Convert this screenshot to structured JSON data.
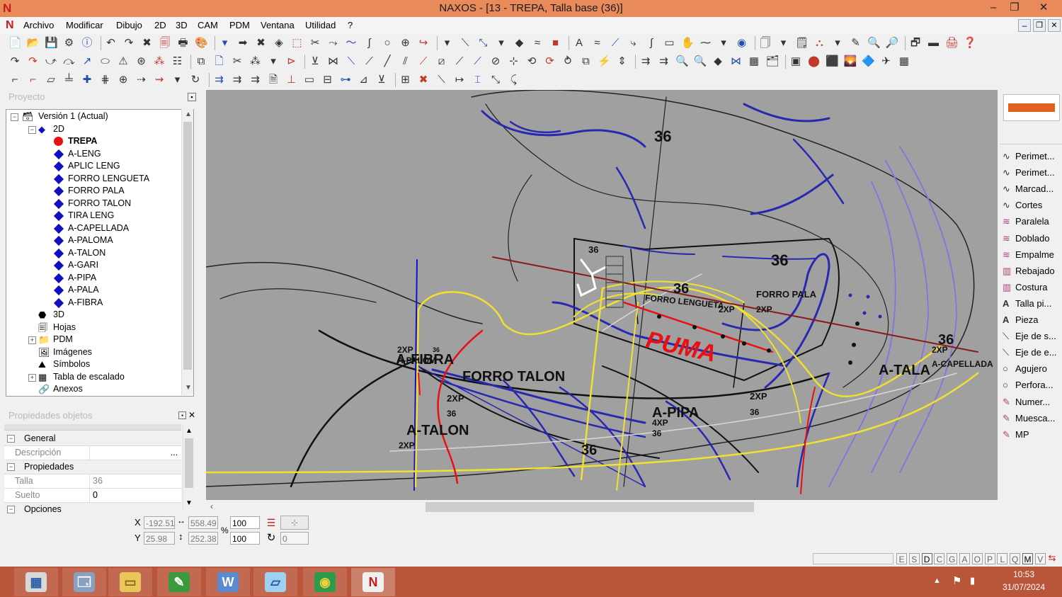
{
  "window": {
    "title": "NAXOS - [13 - TREPA, Talla base (36)]",
    "controls": [
      "‒",
      "❐",
      "✕"
    ],
    "mdi_controls": [
      "‒",
      "❐",
      "✕"
    ]
  },
  "menu": [
    "Archivo",
    "Modificar",
    "Dibujo",
    "2D",
    "3D",
    "CAM",
    "PDM",
    "Ventana",
    "Utilidad",
    "?"
  ],
  "proyecto": {
    "title": "Proyecto",
    "tree": [
      {
        "label": "Versión 1 (Actual)",
        "level": 0,
        "exp": "⊟",
        "icon": "version-icon"
      },
      {
        "label": "2D",
        "level": 1,
        "exp": "⊟",
        "icon": "2d-icon"
      },
      {
        "label": "TREPA",
        "level": 2,
        "icon": "red-dot",
        "bold": true
      },
      {
        "label": "A-LENG",
        "level": 2,
        "icon": "diamond"
      },
      {
        "label": "APLIC LENG",
        "level": 2,
        "icon": "diamond"
      },
      {
        "label": "FORRO LENGUETA",
        "level": 2,
        "icon": "diamond"
      },
      {
        "label": "FORRO PALA",
        "level": 2,
        "icon": "diamond"
      },
      {
        "label": "FORRO TALON",
        "level": 2,
        "icon": "diamond"
      },
      {
        "label": "TIRA LENG",
        "level": 2,
        "icon": "diamond"
      },
      {
        "label": "A-CAPELLADA",
        "level": 2,
        "icon": "diamond"
      },
      {
        "label": "A-PALOMA",
        "level": 2,
        "icon": "diamond"
      },
      {
        "label": "A-TALON",
        "level": 2,
        "icon": "diamond"
      },
      {
        "label": "A-GARI",
        "level": 2,
        "icon": "diamond"
      },
      {
        "label": "A-PIPA",
        "level": 2,
        "icon": "diamond"
      },
      {
        "label": "A-PALA",
        "level": 2,
        "icon": "diamond"
      },
      {
        "label": "A-FIBRA",
        "level": 2,
        "icon": "diamond"
      },
      {
        "label": "3D",
        "level": 1,
        "icon": "3d-icon"
      },
      {
        "label": "Hojas",
        "level": 1,
        "icon": "sheets-icon"
      },
      {
        "label": "PDM",
        "level": 1,
        "exp": "⊞",
        "icon": "folder-icon"
      },
      {
        "label": "Imágenes",
        "level": 1,
        "icon": "images-icon"
      },
      {
        "label": "Símbolos",
        "level": 1,
        "icon": "symbols-icon"
      },
      {
        "label": "Tabla de escalado",
        "level": 1,
        "exp": "⊞",
        "icon": "table-icon"
      },
      {
        "label": "Anexos",
        "level": 1,
        "icon": "attach-icon"
      }
    ]
  },
  "propiedades": {
    "title": "Propiedades objetos",
    "rows": [
      {
        "type": "section",
        "exp": "⊟",
        "label": "General"
      },
      {
        "type": "field",
        "label": "Descripción",
        "value": "",
        "button": "..."
      },
      {
        "type": "section",
        "exp": "⊟",
        "label": "Propiedades"
      },
      {
        "type": "field",
        "label": "Talla",
        "value": "36"
      },
      {
        "type": "field",
        "label": "Suelto",
        "value": "0"
      },
      {
        "type": "section",
        "exp": "⊟",
        "label": "Opciones"
      }
    ]
  },
  "right_panel": {
    "items": [
      {
        "label": "Perimet...",
        "icon": "curve-icon"
      },
      {
        "label": "Perimet...",
        "icon": "curve-icon"
      },
      {
        "label": "Marcad...",
        "icon": "curve-icon"
      },
      {
        "label": "Cortes",
        "icon": "curve-icon"
      },
      {
        "label": "Paralela",
        "icon": "parallel-icon"
      },
      {
        "label": "Doblado",
        "icon": "parallel-icon"
      },
      {
        "label": "Empalme",
        "icon": "parallel-icon"
      },
      {
        "label": "Rebajado",
        "icon": "bar-icon"
      },
      {
        "label": "Costura",
        "icon": "bar-icon"
      },
      {
        "label": "Talla pi...",
        "icon": "text-a-icon"
      },
      {
        "label": "Pieza",
        "icon": "text-a-icon"
      },
      {
        "label": "Eje de s...",
        "icon": "axis-icon"
      },
      {
        "label": "Eje de e...",
        "icon": "axis-icon"
      },
      {
        "label": "Agujero",
        "icon": "circle-icon"
      },
      {
        "label": "Perfora...",
        "icon": "circle-icon"
      },
      {
        "label": "Numer...",
        "icon": "pen-icon"
      },
      {
        "label": "Muesca...",
        "icon": "pen-icon"
      },
      {
        "label": "MP",
        "icon": "pen-icon"
      }
    ]
  },
  "canvas_labels": [
    {
      "text": "36",
      "bold": true
    },
    {
      "text": "36",
      "bold": true
    },
    {
      "text": "36",
      "bold": true
    },
    {
      "text": "36",
      "bold": true
    },
    {
      "text": "FORRO PALA",
      "bold": true
    },
    {
      "text": "2XP",
      "bold": true
    },
    {
      "text": "FORRO LENGUETA",
      "bold": true
    },
    {
      "text": "2XP",
      "bold": true
    },
    {
      "text": "36",
      "bold": true
    },
    {
      "text": "36",
      "bold": true
    },
    {
      "text": "A-TALA",
      "bold": true
    },
    {
      "text": "2XP",
      "bold": true
    },
    {
      "text": "A-CAPELLADA",
      "bold": true
    },
    {
      "text": "2XP",
      "bold": true
    },
    {
      "text": "36",
      "bold": true
    },
    {
      "text": "A-PIPA",
      "bold": true
    },
    {
      "text": "4XP",
      "bold": true
    },
    {
      "text": "36",
      "bold": true
    },
    {
      "text": "36",
      "bold": true
    },
    {
      "text": "FORRO TALON",
      "bold": true
    },
    {
      "text": "2XP",
      "bold": true
    },
    {
      "text": "36",
      "bold": true
    },
    {
      "text": "A-FIBRA",
      "bold": true
    },
    {
      "text": "2XP",
      "bold": true
    },
    {
      "text": "A-PALOM",
      "bold": true
    },
    {
      "text": "36",
      "bold": true
    },
    {
      "text": "A-TALON",
      "bold": true
    },
    {
      "text": "2XP",
      "bold": true
    },
    {
      "text": "PUMA",
      "bold": true
    }
  ],
  "coords": {
    "x_label": "X",
    "y_label": "Y",
    "x": "-192.51",
    "y": "25.98",
    "w": "558.49",
    "h": "252.38",
    "pct_label": "%",
    "scale_x": "100",
    "scale_y": "100",
    "angle": "0"
  },
  "status_letters": [
    "E",
    "S",
    "D",
    "C",
    "G",
    "A",
    "O",
    "P",
    "L",
    "Q",
    "M",
    "V"
  ],
  "taskbar": {
    "time": "10:53",
    "date": "31/07/2024",
    "apps": [
      "calculator-icon",
      "explorer-icon",
      "folder-icon",
      "camtasia-icon",
      "word-icon",
      "notepad-icon",
      "chrome-icon",
      "naxos-icon"
    ]
  },
  "colors": {
    "titlebar": "#e98a5b",
    "taskbar": "#b9563a",
    "canvas": "#a0a0a0",
    "yellow": "#f0e030",
    "blue": "#2828b0",
    "red": "#e81010",
    "violet": "#8a70e0"
  }
}
